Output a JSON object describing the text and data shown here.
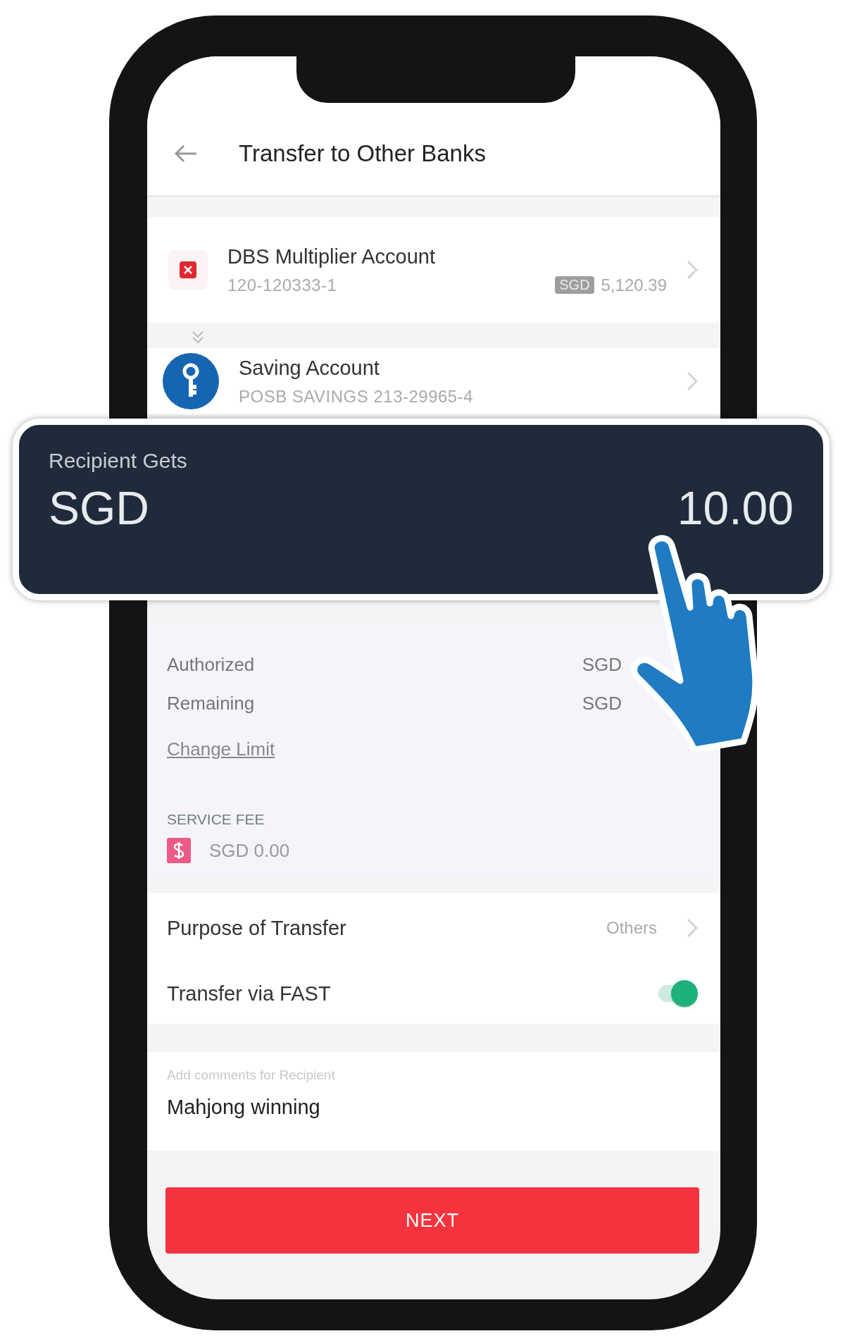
{
  "header": {
    "title": "Transfer to Other Banks"
  },
  "from_account": {
    "name": "DBS Multiplier Account",
    "number": "120-120333-1",
    "currency_badge": "SGD",
    "balance": "5,120.39"
  },
  "to_account": {
    "name": "Saving Account",
    "number": "POSB SAVINGS 213-29965-4"
  },
  "recipient_gets": {
    "label": "Recipient Gets",
    "currency": "SGD",
    "amount": "10.00"
  },
  "limits": {
    "rows": [
      {
        "label": "Authorized",
        "value": "SGD"
      },
      {
        "label": "Remaining",
        "value": "SGD"
      }
    ],
    "link": "Change Limit"
  },
  "service_fee": {
    "title": "SERVICE FEE",
    "value": "SGD 0.00"
  },
  "options": [
    {
      "kind": "select",
      "label": "Purpose of Transfer",
      "value": "Others"
    },
    {
      "kind": "switch",
      "label": "Transfer via FAST",
      "on": true
    }
  ],
  "comment": {
    "placeholder": "Add comments for Recipient",
    "value": "Mahjong winning"
  },
  "next_button": "NEXT"
}
